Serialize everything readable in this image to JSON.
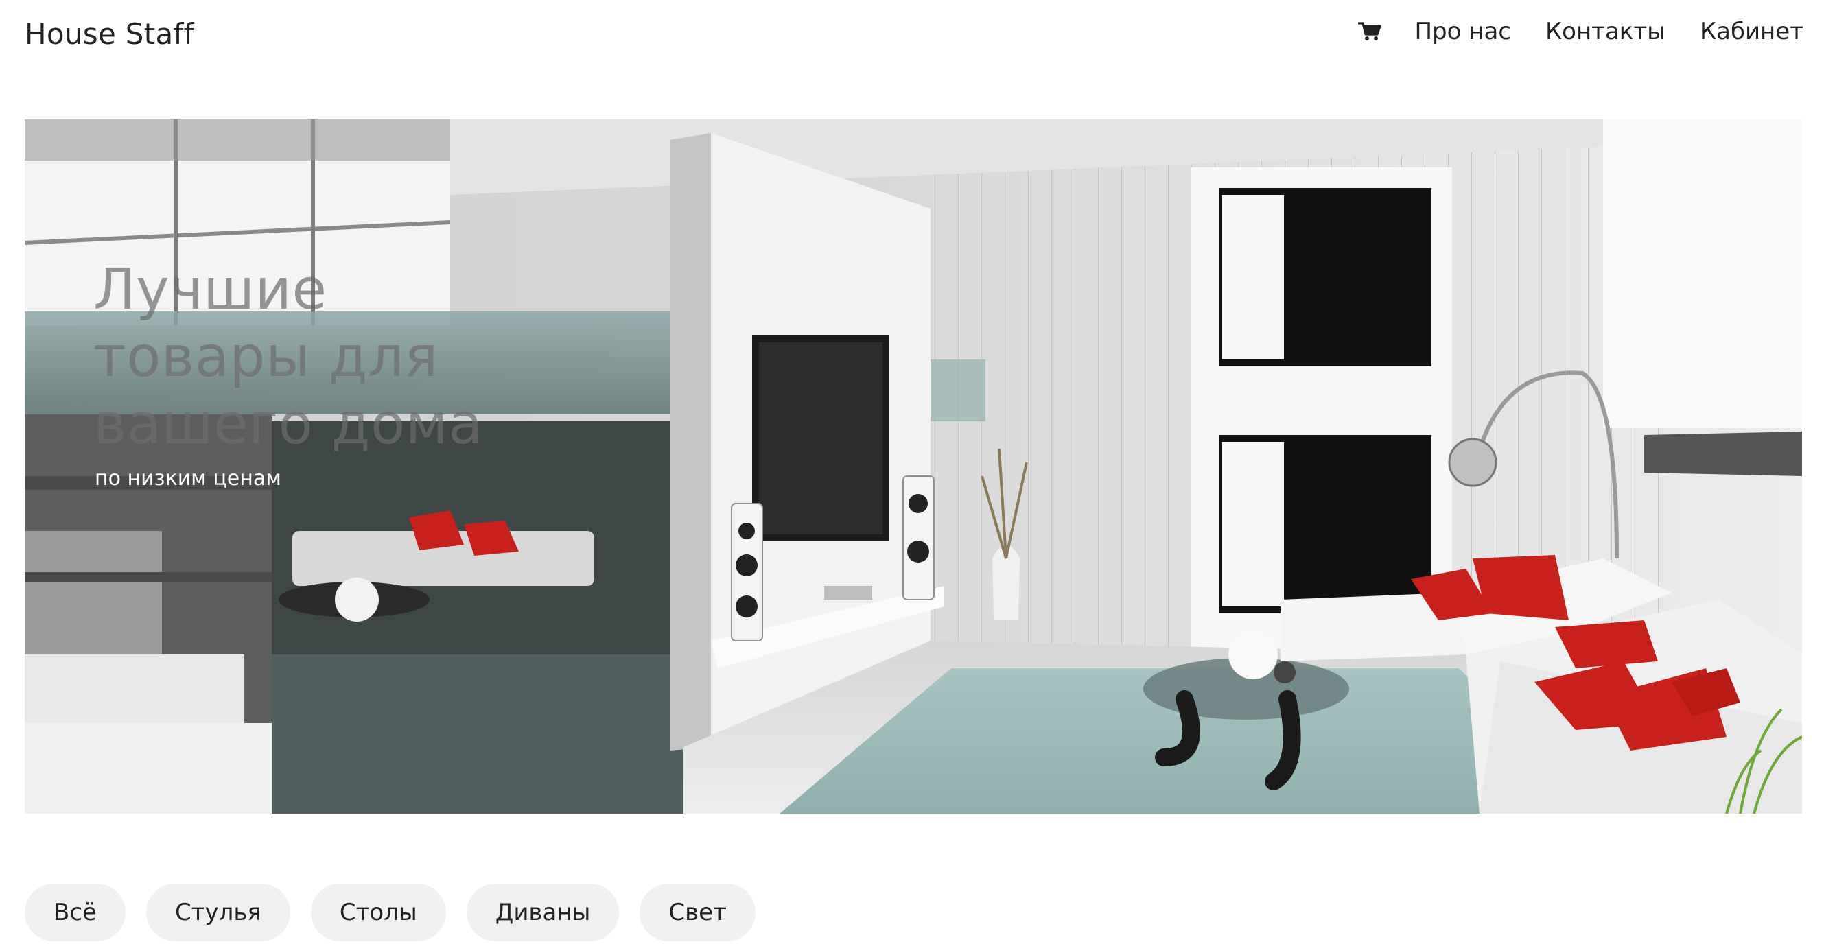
{
  "brand": {
    "name": "House Staff"
  },
  "nav": {
    "cart_icon": "shopping-cart-icon",
    "links": [
      {
        "label": "Про нас"
      },
      {
        "label": "Контакты"
      },
      {
        "label": "Кабинет"
      }
    ]
  },
  "hero": {
    "title": "Лучшие товары для вашего дома",
    "subtitle": "по низким ценам"
  },
  "filters": {
    "chips": [
      {
        "label": "Всё"
      },
      {
        "label": "Стулья"
      },
      {
        "label": "Столы"
      },
      {
        "label": "Диваны"
      },
      {
        "label": "Свет"
      }
    ]
  },
  "colors": {
    "text": "#222222",
    "chip_bg": "#f0f0f0",
    "accent_red": "#c8201a",
    "glass_teal": "#9fbcbc"
  }
}
